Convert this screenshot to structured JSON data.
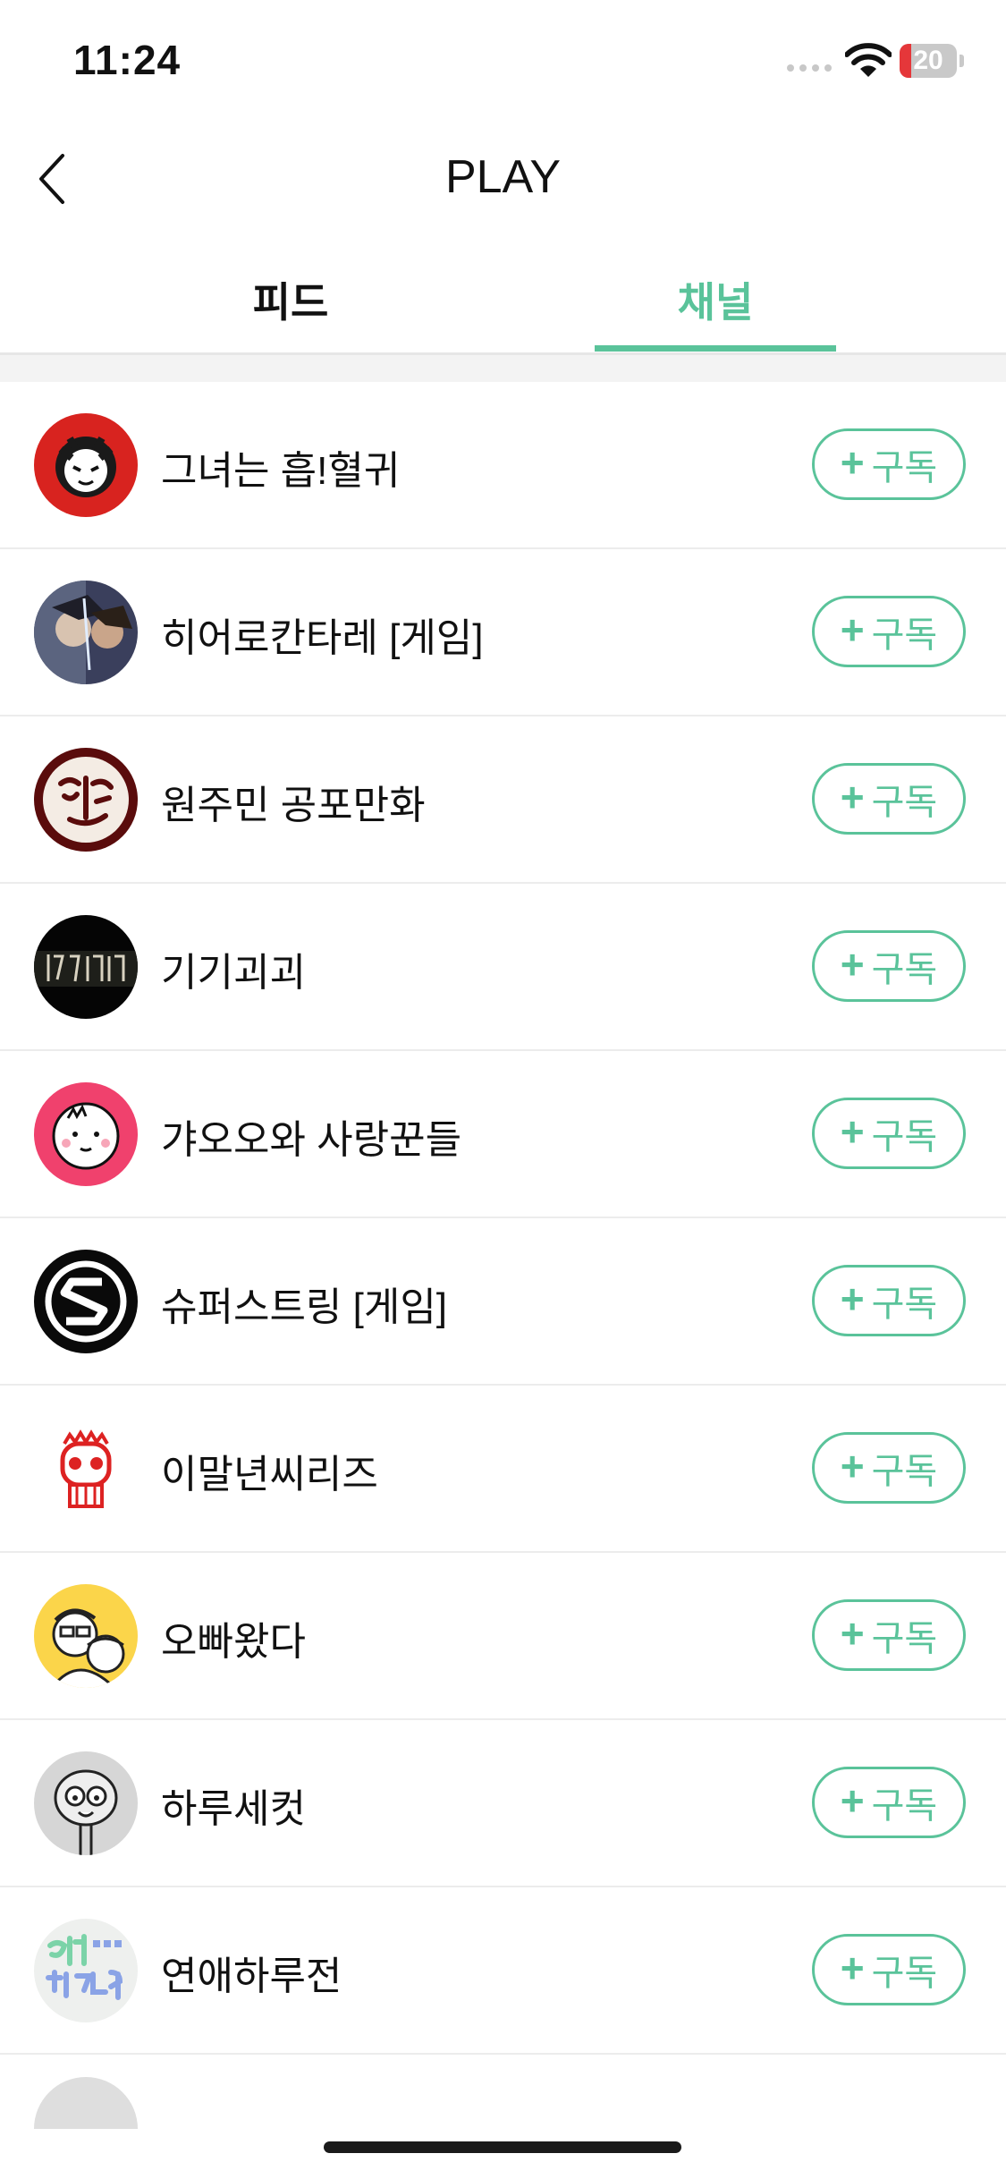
{
  "status_bar": {
    "time": "11:24",
    "battery_level": "20",
    "battery_color": "#e5373a"
  },
  "nav": {
    "title": "PLAY",
    "back_icon": "chevron-left-icon"
  },
  "tabs": [
    {
      "label": "피드",
      "active": false
    },
    {
      "label": "채널",
      "active": true
    }
  ],
  "accent_color": "#5ac39a",
  "channels": [
    {
      "name": "그녀는 흡!혈귀",
      "button_label": "구독",
      "avatar": "red-vampire-avatar"
    },
    {
      "name": "히어로칸타레 [게임]",
      "button_label": "구독",
      "avatar": "hero-illustration-avatar"
    },
    {
      "name": "원주민 공포만화",
      "button_label": "구독",
      "avatar": "brush-seal-avatar"
    },
    {
      "name": "기기괴괴",
      "button_label": "구독",
      "avatar": "dark-title-avatar"
    },
    {
      "name": "갸오오와 사랑꾼들",
      "button_label": "구독",
      "avatar": "pink-face-avatar"
    },
    {
      "name": "슈퍼스트링 [게임]",
      "button_label": "구독",
      "avatar": "superstring-logo-avatar"
    },
    {
      "name": "이말년씨리즈",
      "button_label": "구독",
      "avatar": "red-skull-avatar"
    },
    {
      "name": "오빠왔다",
      "button_label": "구독",
      "avatar": "yellow-sketch-avatar"
    },
    {
      "name": "하루세컷",
      "button_label": "구독",
      "avatar": "grey-alien-avatar"
    },
    {
      "name": "연애하루전",
      "button_label": "구독",
      "avatar": "pastel-text-avatar"
    }
  ]
}
